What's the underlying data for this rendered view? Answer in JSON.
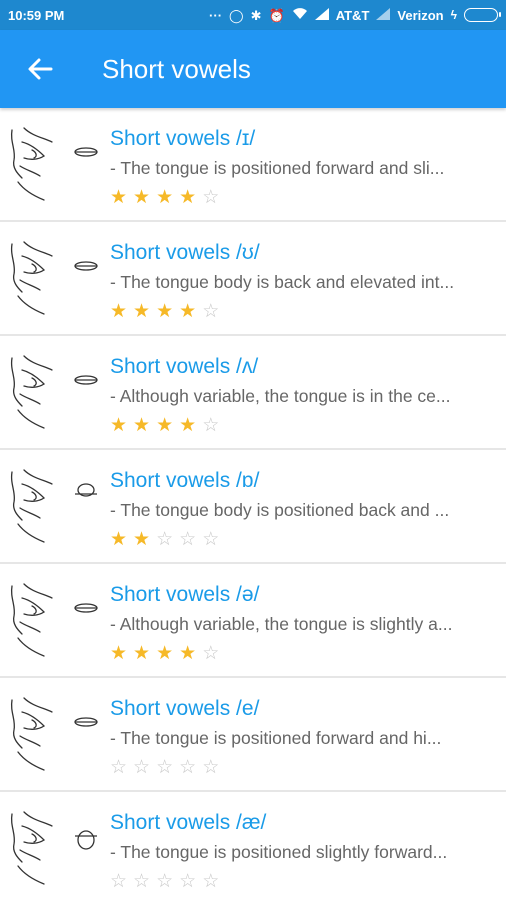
{
  "status_bar": {
    "time": "10:59 PM",
    "carrier_1": "AT&T",
    "carrier_2": "Verizon"
  },
  "app_bar": {
    "title": "Short vowels",
    "back_icon": "arrow-left-icon"
  },
  "colors": {
    "status_bar": "#1e88cf",
    "app_bar": "#2196f3",
    "title_text": "#1a9be8",
    "star_on": "#f6b928",
    "star_off": "#c8c8c8"
  },
  "items": [
    {
      "title": "Short vowels /ɪ/",
      "desc": "- The tongue is positioned forward and sli...",
      "rating": 4,
      "max": 5
    },
    {
      "title": "Short vowels /ʊ/",
      "desc": "- The tongue body is back and elevated int...",
      "rating": 4,
      "max": 5
    },
    {
      "title": "Short vowels /ʌ/",
      "desc": "- Although variable, the tongue is in the ce...",
      "rating": 4,
      "max": 5
    },
    {
      "title": "Short vowels /ɒ/",
      "desc": "- The tongue body is positioned back and ...",
      "rating": 2,
      "max": 5
    },
    {
      "title": "Short vowels /ə/",
      "desc": "- Although variable, the tongue is slightly a...",
      "rating": 4,
      "max": 5
    },
    {
      "title": "Short vowels /e/",
      "desc": "- The tongue is positioned forward and hi...",
      "rating": 0,
      "max": 5
    },
    {
      "title": "Short vowels /æ/",
      "desc": "- The tongue is positioned slightly forward...",
      "rating": 0,
      "max": 5
    }
  ]
}
